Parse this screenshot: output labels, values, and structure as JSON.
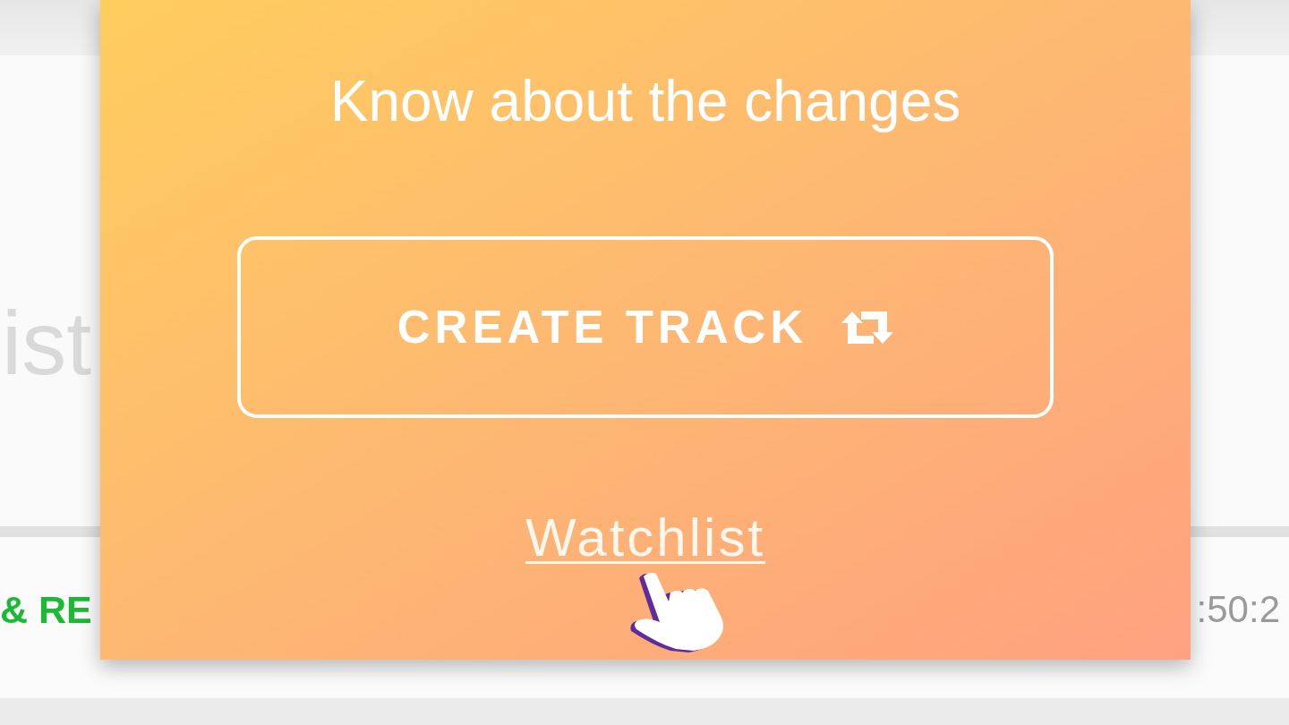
{
  "background": {
    "heading": "ist",
    "row": {
      "status": "& RE",
      "time": ":50:2"
    }
  },
  "modal": {
    "title": "Know about the changes",
    "button": {
      "label": "CREATE TRACK"
    },
    "link": "Watchlist"
  }
}
